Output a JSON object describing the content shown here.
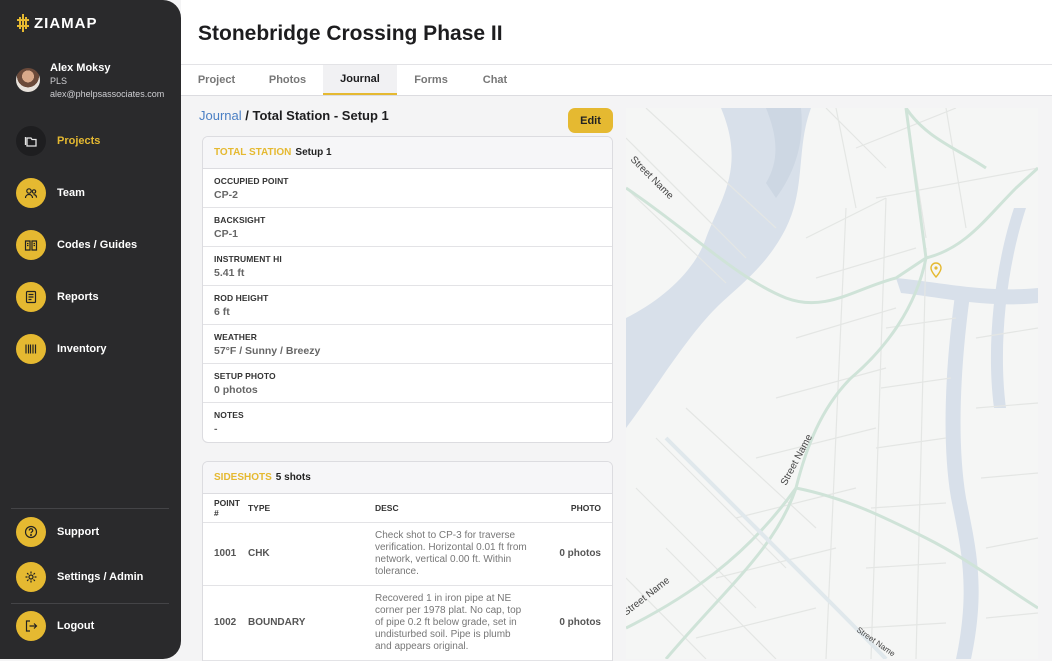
{
  "app": {
    "logo_text": "ZIAMAP"
  },
  "user": {
    "name": "Alex Moksy",
    "role": "PLS",
    "email": "alex@phelpsassociates.com"
  },
  "sidebar": {
    "nav": [
      {
        "label": "Projects",
        "icon": "folder-icon",
        "active": true
      },
      {
        "label": "Team",
        "icon": "users-icon"
      },
      {
        "label": "Codes / Guides",
        "icon": "book-icon"
      },
      {
        "label": "Reports",
        "icon": "document-icon"
      },
      {
        "label": "Inventory",
        "icon": "barcode-icon"
      }
    ],
    "bottom": [
      {
        "label": "Support",
        "icon": "help-icon"
      },
      {
        "label": "Settings / Admin",
        "icon": "gear-icon"
      },
      {
        "label": "Logout",
        "icon": "logout-icon"
      }
    ]
  },
  "header": {
    "title": "Stonebridge Crossing Phase II"
  },
  "tabs": [
    {
      "label": "Project"
    },
    {
      "label": "Photos"
    },
    {
      "label": "Journal",
      "active": true
    },
    {
      "label": "Forms"
    },
    {
      "label": "Chat"
    }
  ],
  "breadcrumb": {
    "parent": "Journal",
    "separator": " / ",
    "current": "Total Station - Setup 1"
  },
  "actions": {
    "edit_label": "Edit"
  },
  "setup_card": {
    "kind": "TOTAL STATION",
    "title": "Setup 1",
    "fields": [
      {
        "label": "OCCUPIED POINT",
        "value": "CP-2"
      },
      {
        "label": "BACKSIGHT",
        "value": "CP-1"
      },
      {
        "label": "INSTRUMENT HI",
        "value": "5.41 ft"
      },
      {
        "label": "ROD HEIGHT",
        "value": "6 ft"
      },
      {
        "label": "WEATHER",
        "value": "57°F / Sunny / Breezy"
      },
      {
        "label": "SETUP PHOTO",
        "value": "0 photos"
      },
      {
        "label": "NOTES",
        "value": "-"
      }
    ]
  },
  "sideshots": {
    "kind": "SIDESHOTS",
    "count_label": "5 shots",
    "columns": {
      "point": "POINT #",
      "type": "TYPE",
      "desc": "DESC",
      "photo": "PHOTO"
    },
    "rows": [
      {
        "point": "1001",
        "type": "CHK",
        "desc": "Check shot to CP-3 for traverse verification. Horizontal 0.01 ft from network, vertical 0.00 ft. Within tolerance.",
        "photo": "0 photos"
      },
      {
        "point": "1002",
        "type": "BOUNDARY",
        "desc": "Recovered 1 in iron pipe at NE corner per 1978 plat. No cap, top of pipe 0.2 ft below grade, set in undisturbed soil. Pipe is plumb and appears original.",
        "photo": "0 photos"
      }
    ]
  },
  "map": {
    "street_labels": [
      "Street Name",
      "Street Name",
      "Street Name",
      "Street Name"
    ],
    "water_color": "#d8e0ea",
    "road_color": "#cfe3d8",
    "pin_color": "#e5b931"
  }
}
